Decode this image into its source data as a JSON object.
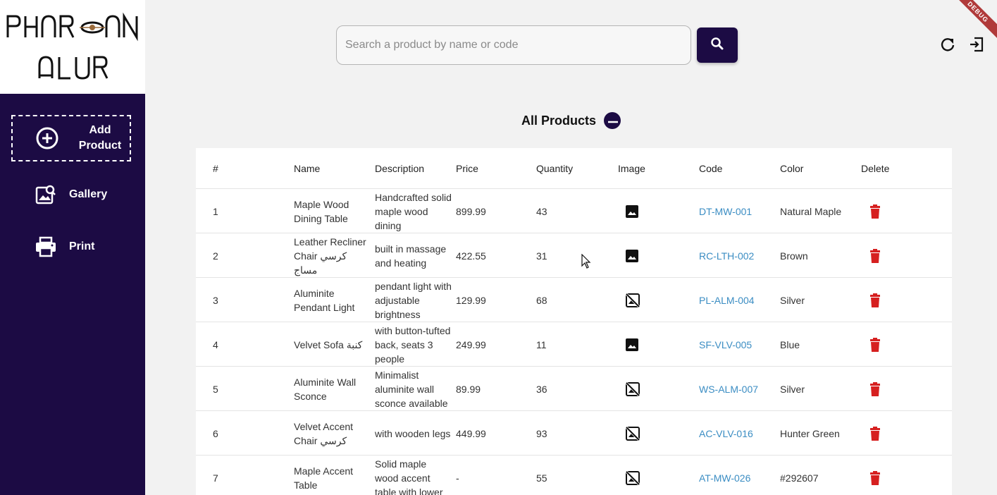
{
  "brand": {
    "logo_text": "PHAROAN ALUR"
  },
  "sidebar": {
    "add_product_label": "Add Product",
    "items": [
      {
        "label": "Gallery",
        "icon": "gallery-icon"
      },
      {
        "label": "Print",
        "icon": "printer-icon"
      }
    ]
  },
  "header": {
    "search_placeholder": "Search a product by name or code",
    "search_value": "",
    "debug_badge": "DEBUG"
  },
  "page": {
    "title": "All Products"
  },
  "table": {
    "columns": [
      "#",
      "Name",
      "Description",
      "Price",
      "Quantity",
      "Image",
      "Code",
      "Color",
      "Delete"
    ],
    "rows": [
      {
        "num": "1",
        "name": "Maple Wood Dining Table",
        "description": "Handcrafted solid maple wood dining",
        "price": "899.99",
        "quantity": "43",
        "has_image": true,
        "code": "DT-MW-001",
        "color": "Natural Maple"
      },
      {
        "num": "2",
        "name": "Leather Recliner Chair كرسي مساج",
        "description": "built in massage and heating",
        "price": "422.55",
        "quantity": "31",
        "has_image": true,
        "code": "RC-LTH-002",
        "color": "Brown"
      },
      {
        "num": "3",
        "name": "Aluminite Pendant Light",
        "description": "pendant light with adjustable brightness",
        "price": "129.99",
        "quantity": "68",
        "has_image": false,
        "code": "PL-ALM-004",
        "color": "Silver"
      },
      {
        "num": "4",
        "name": "Velvet Sofa كنبة",
        "description": "with button-tufted back, seats 3 people",
        "price": "249.99",
        "quantity": "11",
        "has_image": true,
        "code": "SF-VLV-005",
        "color": "Blue"
      },
      {
        "num": "5",
        "name": "Aluminite Wall Sconce",
        "description": "Minimalist aluminite wall sconce available",
        "price": "89.99",
        "quantity": "36",
        "has_image": false,
        "code": "WS-ALM-007",
        "color": "Silver"
      },
      {
        "num": "6",
        "name": "Velvet Accent Chair كرسي",
        "description": "with wooden legs",
        "price": "449.99",
        "quantity": "93",
        "has_image": false,
        "code": "AC-VLV-016",
        "color": "Hunter Green"
      },
      {
        "num": "7",
        "name": "Maple Accent Table",
        "description": "Solid maple wood accent table with lower",
        "price": "-",
        "quantity": "55",
        "has_image": false,
        "code": "AT-MW-026",
        "color": "#292607"
      }
    ]
  },
  "colors": {
    "sidebar_bg": "#1c0b44",
    "accent": "#1c0b44",
    "code_link": "#3b8dc3",
    "delete": "#d62020"
  }
}
